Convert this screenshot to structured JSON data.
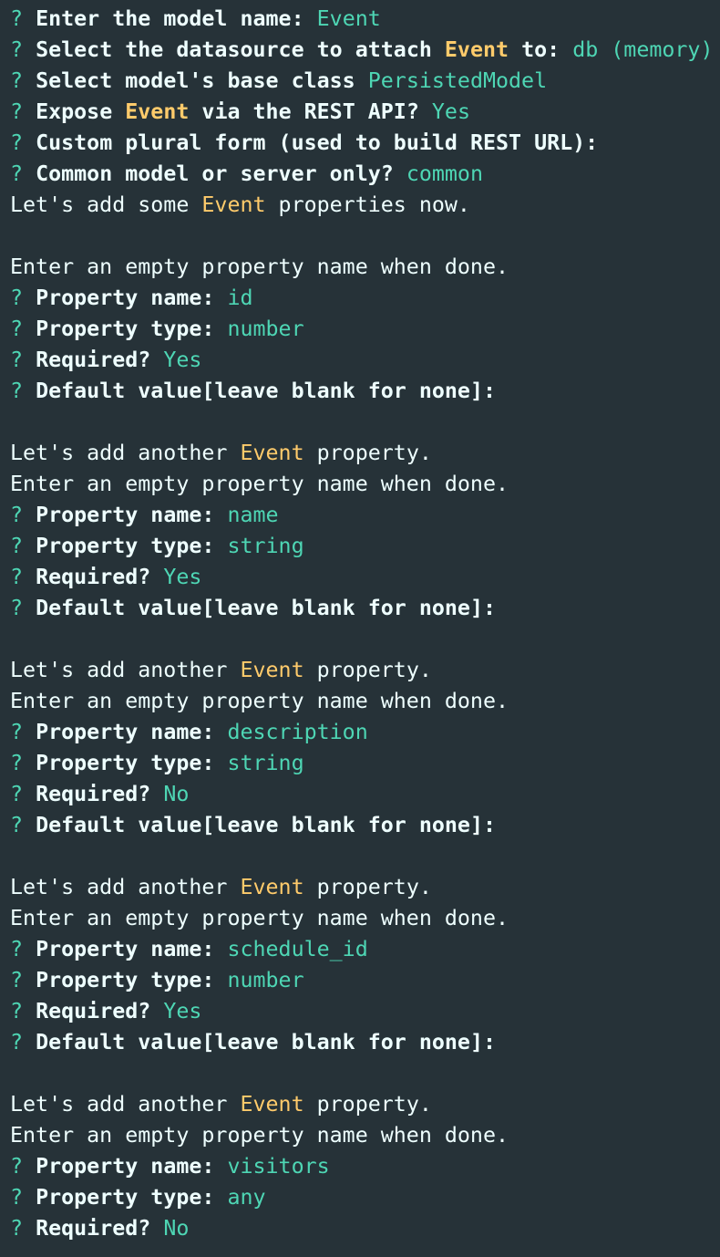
{
  "colors": {
    "background": "#263238",
    "text": "#eeffff",
    "answer": "#4ed6b4",
    "highlight": "#ffcb6b"
  },
  "terminal": {
    "prompt_mark": "?",
    "model_prompts": [
      {
        "parts": [
          {
            "t": "Enter the model name: "
          },
          {
            "t": "Event",
            "c": "answer"
          }
        ]
      },
      {
        "parts": [
          {
            "t": "Select the datasource to attach "
          },
          {
            "t": "Event",
            "c": "highlight-bold"
          },
          {
            "t": " to: "
          },
          {
            "t": "db (memory)",
            "c": "answer"
          }
        ]
      },
      {
        "parts": [
          {
            "t": "Select model's base class "
          },
          {
            "t": "PersistedModel",
            "c": "answer"
          }
        ]
      },
      {
        "parts": [
          {
            "t": "Expose "
          },
          {
            "t": "Event",
            "c": "highlight-bold"
          },
          {
            "t": " via the REST API? "
          },
          {
            "t": "Yes",
            "c": "answer"
          }
        ]
      },
      {
        "parts": [
          {
            "t": "Custom plural form (used to build REST URL):"
          }
        ]
      },
      {
        "parts": [
          {
            "t": "Common model or server only? "
          },
          {
            "t": "common",
            "c": "answer"
          }
        ]
      }
    ],
    "intro": {
      "before": "Let's add some ",
      "model": "Event",
      "after": " properties now."
    },
    "another_intro": {
      "before": "Let's add another ",
      "model": "Event",
      "after": " property."
    },
    "empty_hint": "Enter an empty property name when done.",
    "labels": {
      "property_name": "Property name: ",
      "property_type": "Property type: ",
      "required": "Required? ",
      "default_value": "Default value[leave blank for none]:"
    },
    "properties": [
      {
        "name": "id",
        "type": "number",
        "required": "Yes",
        "show_default": true
      },
      {
        "name": "name",
        "type": "string",
        "required": "Yes",
        "show_default": true
      },
      {
        "name": "description",
        "type": "string",
        "required": "No",
        "show_default": true
      },
      {
        "name": "schedule_id",
        "type": "number",
        "required": "Yes",
        "show_default": true
      },
      {
        "name": "visitors",
        "type": "any",
        "required": "No",
        "show_default": false
      }
    ]
  }
}
